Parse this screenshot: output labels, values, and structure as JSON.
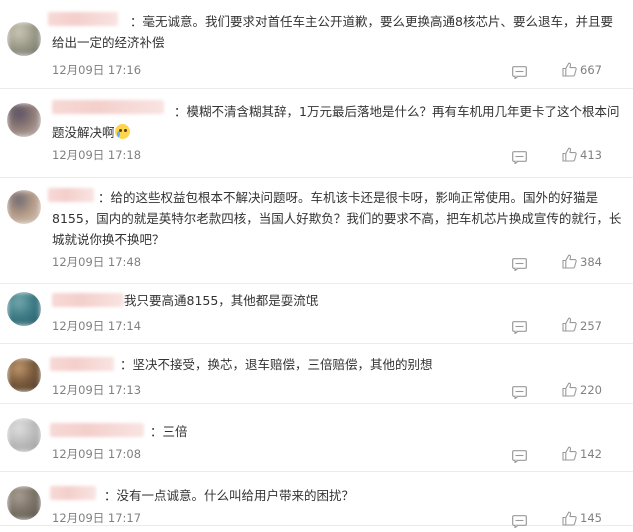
{
  "comments": [
    {
      "text": "：毫无诚意。我们要求对首任车主公开道歉，要么更换高通8核芯片、要么退车，并且要给出一定的经济补偿",
      "time": "12月09日 17:16",
      "likes": "667",
      "avatar_colors": [
        "#9c9b8a",
        "#cfc9b8",
        "#6d6c62"
      ]
    },
    {
      "text": "：模糊不清含糊其辞，1万元最后落地是什么？再有车机用几年更卡了这个根本问题没解决啊",
      "emoji": "crying-face",
      "time": "12月09日 17:18",
      "likes": "413",
      "avatar_colors": [
        "#8c7a74",
        "#5b5166",
        "#c8bcb6"
      ]
    },
    {
      "text": "：给的这些权益包根本不解决问题呀。车机该卡还是很卡呀，影响正常使用。国外的好猫是8155，国内的就是英特尔老款四核，当国人好欺负？我们的要求不高，把车机芯片换成宣传的就行，长城就说你换不换吧？",
      "time": "12月09日 17:48",
      "likes": "384",
      "avatar_colors": [
        "#b59a86",
        "#6e6a73",
        "#d8cdc4"
      ]
    },
    {
      "text": "我只要高通8155，其他都是耍流氓",
      "time": "12月09日 17:14",
      "likes": "257",
      "avatar_colors": [
        "#3c7b86",
        "#78a9ae",
        "#2a5a66"
      ]
    },
    {
      "text": "：坚决不接受，换芯，退车赔偿，三倍赔偿，其他的别想",
      "time": "12月09日 17:13",
      "likes": "220",
      "avatar_colors": [
        "#7a5a3c",
        "#c29a6e",
        "#4e3a28"
      ]
    },
    {
      "text": "：三倍",
      "time": "12月09日 17:08",
      "likes": "142",
      "avatar_colors": [
        "#bdbdbd",
        "#e0e0e0",
        "#9a9a9a"
      ]
    },
    {
      "text": "：没有一点诚意。什么叫给用户带来的困扰？",
      "time": "12月09日 17:17",
      "likes": "145",
      "avatar_colors": [
        "#7d7468",
        "#a99f92",
        "#56504a"
      ]
    }
  ],
  "icons": {
    "reply": "comment-icon",
    "like": "thumbs-up-icon",
    "emoji": "crying-face-icon"
  }
}
